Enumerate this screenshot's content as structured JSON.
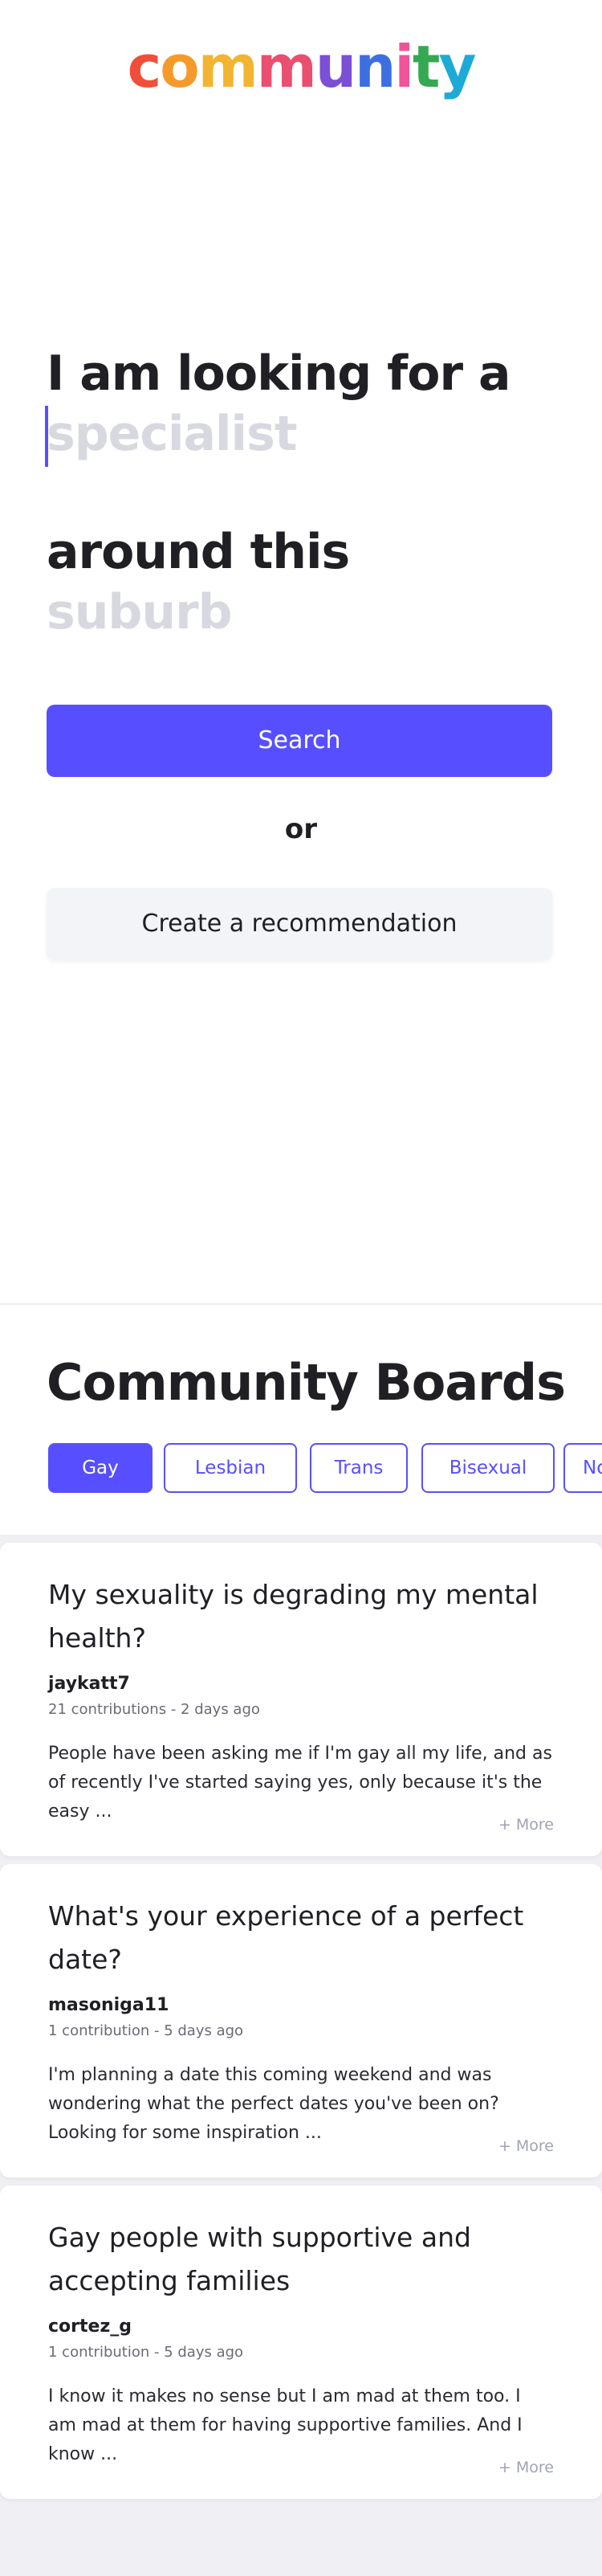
{
  "logo": {
    "letters": [
      {
        "ch": "c",
        "color": "#f04e3a"
      },
      {
        "ch": "o",
        "color": "#f59a2a"
      },
      {
        "ch": "m",
        "color": "#f2b431"
      },
      {
        "ch": "m",
        "color": "#e94f6e"
      },
      {
        "ch": "u",
        "color": "#7b4fd6"
      },
      {
        "ch": "n",
        "color": "#3d6fe0"
      },
      {
        "ch": "i",
        "color": "#f0539a"
      },
      {
        "ch": "t",
        "color": "#35a853"
      },
      {
        "ch": "y",
        "color": "#1eaad7"
      }
    ]
  },
  "hero": {
    "line1": "I am looking for a",
    "specialist_placeholder": "specialist",
    "line2": "around this",
    "suburb_placeholder": "suburb",
    "search_label": "Search",
    "or_label": "or",
    "create_label": "Create a recommendation"
  },
  "boards": {
    "title": "Community Boards",
    "chips": [
      {
        "label": "Gay",
        "active": true
      },
      {
        "label": "Lesbian",
        "active": false
      },
      {
        "label": "Trans",
        "active": false
      },
      {
        "label": "Bisexual",
        "active": false
      },
      {
        "label": "No",
        "active": false
      }
    ],
    "posts": [
      {
        "title": "My sexuality is degrading my mental health?",
        "author": "jaykatt7",
        "meta": "21 contributions - 2 days ago",
        "body": "People have been asking me if I'm gay all my life, and as of recently I've started saying yes, only because it's the easy ...",
        "more": "+ More"
      },
      {
        "title": "What's your experience of a perfect date?",
        "author": "masoniga11",
        "meta": "1 contribution - 5 days ago",
        "body": "I'm planning a date this coming weekend and was wondering what the perfect dates you've been on? Looking for some inspiration ...",
        "more": "+ More"
      },
      {
        "title": "Gay people with supportive and accepting families",
        "author": "cortez_g",
        "meta": "1 contribution - 5 days ago",
        "body": "I know it makes no sense but I am mad at them too. I am mad at them for having supportive families. And I know ...",
        "more": "+ More"
      }
    ]
  },
  "colors": {
    "accent": "#574fff",
    "placeholder": "#d8d9e0",
    "text": "#1f1f24"
  }
}
